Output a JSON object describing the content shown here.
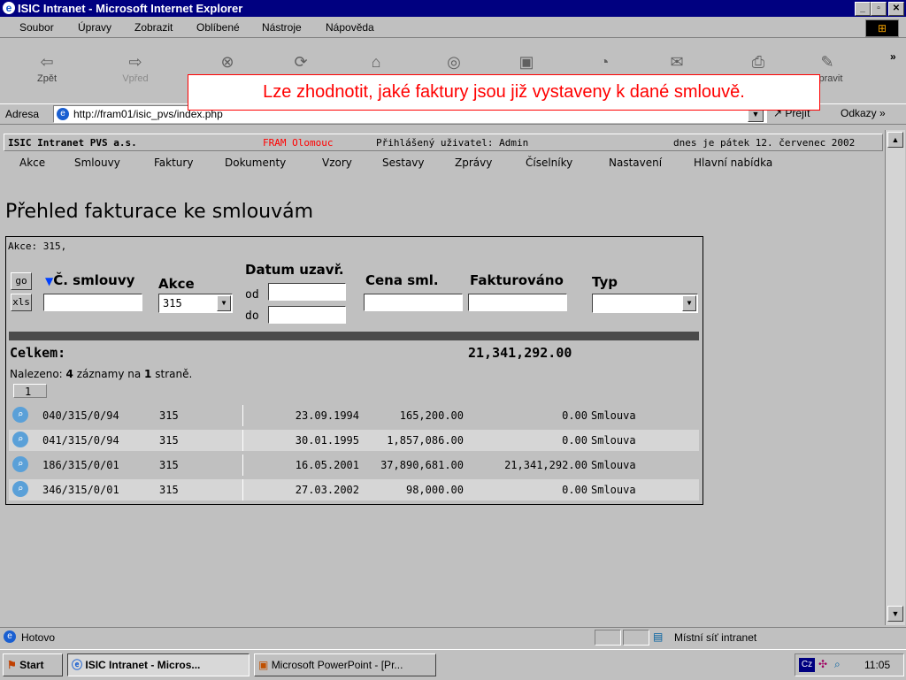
{
  "window": {
    "title": "ISIC Intranet - Microsoft Internet Explorer"
  },
  "menu": [
    "Soubor",
    "Úpravy",
    "Zobrazit",
    "Oblíbené",
    "Nástroje",
    "Nápověda"
  ],
  "toolbar": {
    "back": "Zpět",
    "forward": "Vpřed",
    "edit": "Upravit"
  },
  "address": {
    "label": "Adresa",
    "url": "http://fram01/isic_pvs/index.php",
    "go": "Přejít",
    "links": "Odkazy"
  },
  "callout": "Lze zhodnotit, jaké faktury jsou již vystaveny k dané smlouvě.",
  "info": {
    "company": "ISIC Intranet PVS a.s.",
    "org": "FRAM Olomouc",
    "user": "Přihlášený uživatel: Admin",
    "date": "dnes je pátek 12. červenec 2002"
  },
  "nav": [
    "Akce",
    "Smlouvy",
    "Faktury",
    "Dokumenty",
    "Vzory",
    "Sestavy",
    "Zprávy",
    "Číselníky",
    "Nastavení",
    "Hlavní nabídka"
  ],
  "page": {
    "title": "Přehled fakturace ke smlouvám",
    "filter_info": "Akce: 315,",
    "go_label": "go",
    "xls_label": "xls",
    "columns": {
      "contract": "Č. smlouvy",
      "akce": "Akce",
      "date": "Datum uzavř.",
      "price": "Cena sml.",
      "invoiced": "Fakturováno",
      "type": "Typ"
    },
    "date_from": "od",
    "date_to": "do",
    "akce_value": "315",
    "total_label": "Celkem:",
    "total_value": "21,341,292.00",
    "found_prefix": "Nalezeno:",
    "found_count": "4",
    "found_mid": "záznamy na",
    "found_pages": "1",
    "found_suffix": "straně.",
    "page_number": "1",
    "rows": [
      {
        "contract": "040/315/0/94",
        "akce": "315",
        "date": "23.09.1994",
        "price": "165,200.00",
        "invoiced": "0.00",
        "type": "Smlouva"
      },
      {
        "contract": "041/315/0/94",
        "akce": "315",
        "date": "30.01.1995",
        "price": "1,857,086.00",
        "invoiced": "0.00",
        "type": "Smlouva"
      },
      {
        "contract": "186/315/0/01",
        "akce": "315",
        "date": "16.05.2001",
        "price": "37,890,681.00",
        "invoiced": "21,341,292.00",
        "type": "Smlouva"
      },
      {
        "contract": "346/315/0/01",
        "akce": "315",
        "date": "27.03.2002",
        "price": "98,000.00",
        "invoiced": "0.00",
        "type": "Smlouva"
      }
    ]
  },
  "status": {
    "text": "Hotovo",
    "zone": "Místní síť intranet"
  },
  "taskbar": {
    "start": "Start",
    "task1": "ISIC Intranet - Micros...",
    "task2": "Microsoft PowerPoint - [Pr...",
    "lang": "Cz",
    "time": "11:05"
  }
}
